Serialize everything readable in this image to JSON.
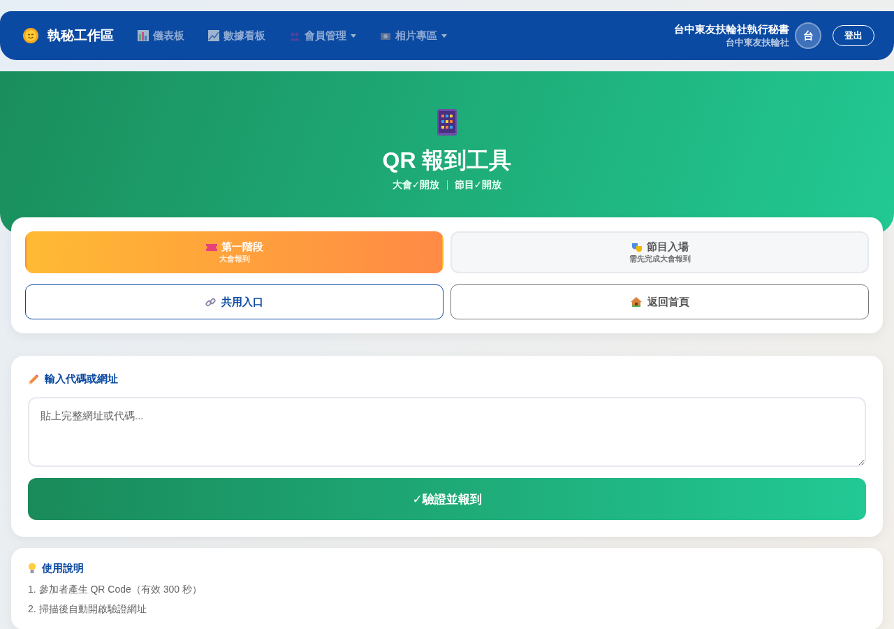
{
  "navbar": {
    "brand": "執秘工作區",
    "items": [
      {
        "label": "儀表板",
        "dropdown": false
      },
      {
        "label": "數據看板",
        "dropdown": false
      },
      {
        "label": "會員管理",
        "dropdown": true
      },
      {
        "label": "相片專區",
        "dropdown": true
      }
    ],
    "user": {
      "name": "台中東友扶輪社執行秘書",
      "club": "台中東友扶輪社",
      "avatar": "台"
    },
    "logout": "登出"
  },
  "hero": {
    "title": "QR 報到工具",
    "statuses": [
      "大會✓開放",
      "節目✓開放"
    ]
  },
  "stages": [
    {
      "title": "第一階段",
      "subtitle": "大會報到",
      "selected": true
    },
    {
      "title": "節目入場",
      "subtitle": "需先完成大會報到",
      "selected": false
    }
  ],
  "links": [
    {
      "label": "共用入口",
      "kind": "primary"
    },
    {
      "label": "返回首頁",
      "kind": "secondary"
    }
  ],
  "input_card": {
    "heading": "輸入代碼或網址",
    "placeholder": "貼上完整網址或代碼...",
    "submit": "✓驗證並報到"
  },
  "help": {
    "heading": "使用說明",
    "steps": [
      "1. 參加者產生 QR Code（有效 300 秒）",
      "2. 掃描後自動開啟驗證網址"
    ]
  }
}
